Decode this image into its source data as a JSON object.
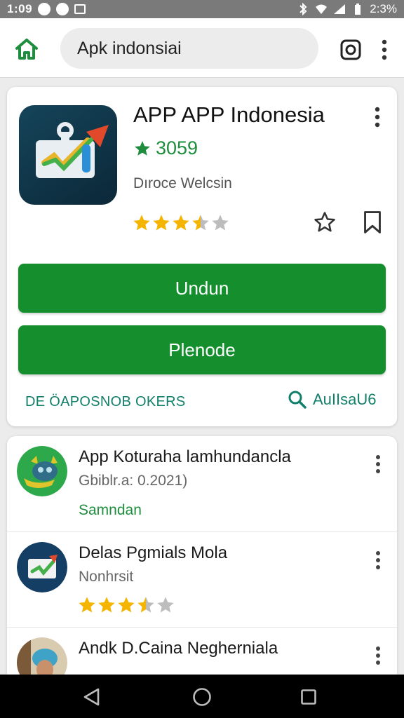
{
  "status_bar": {
    "time": "1:09",
    "battery_text": "2:3%"
  },
  "search": {
    "query": "Apk indonsiai"
  },
  "app": {
    "title": "APP  APP Indonesia",
    "rating": "3059",
    "developer": "Dıroce Welcsin",
    "star_rating": 3.5,
    "primary_button": "Undun",
    "secondary_button": "Plenode",
    "footer_left": "DE ÖAPOSNOB OKERS",
    "footer_right": "AuIIsaU6"
  },
  "list": [
    {
      "title": "App Koturaha  lamhundancla",
      "subtitle": "Gbiblr.a: 0.2021)",
      "tag": "Samndan"
    },
    {
      "title": "Delas Pgmials Mola",
      "subtitle": "Nonhrsit",
      "stars": 3.5
    },
    {
      "title": "Andk D.Caina Negherniala"
    }
  ],
  "colors": {
    "accent_green": "#158f2e",
    "teal_text": "#127f6a",
    "rating_green": "#1e8e3e",
    "star_gold": "#f4b400"
  },
  "icons": [
    "home-icon",
    "camera-icon",
    "more-vert-icon",
    "star-outline-icon",
    "bookmark-icon",
    "search-icon",
    "back-icon",
    "home-circle-icon",
    "recents-icon"
  ]
}
